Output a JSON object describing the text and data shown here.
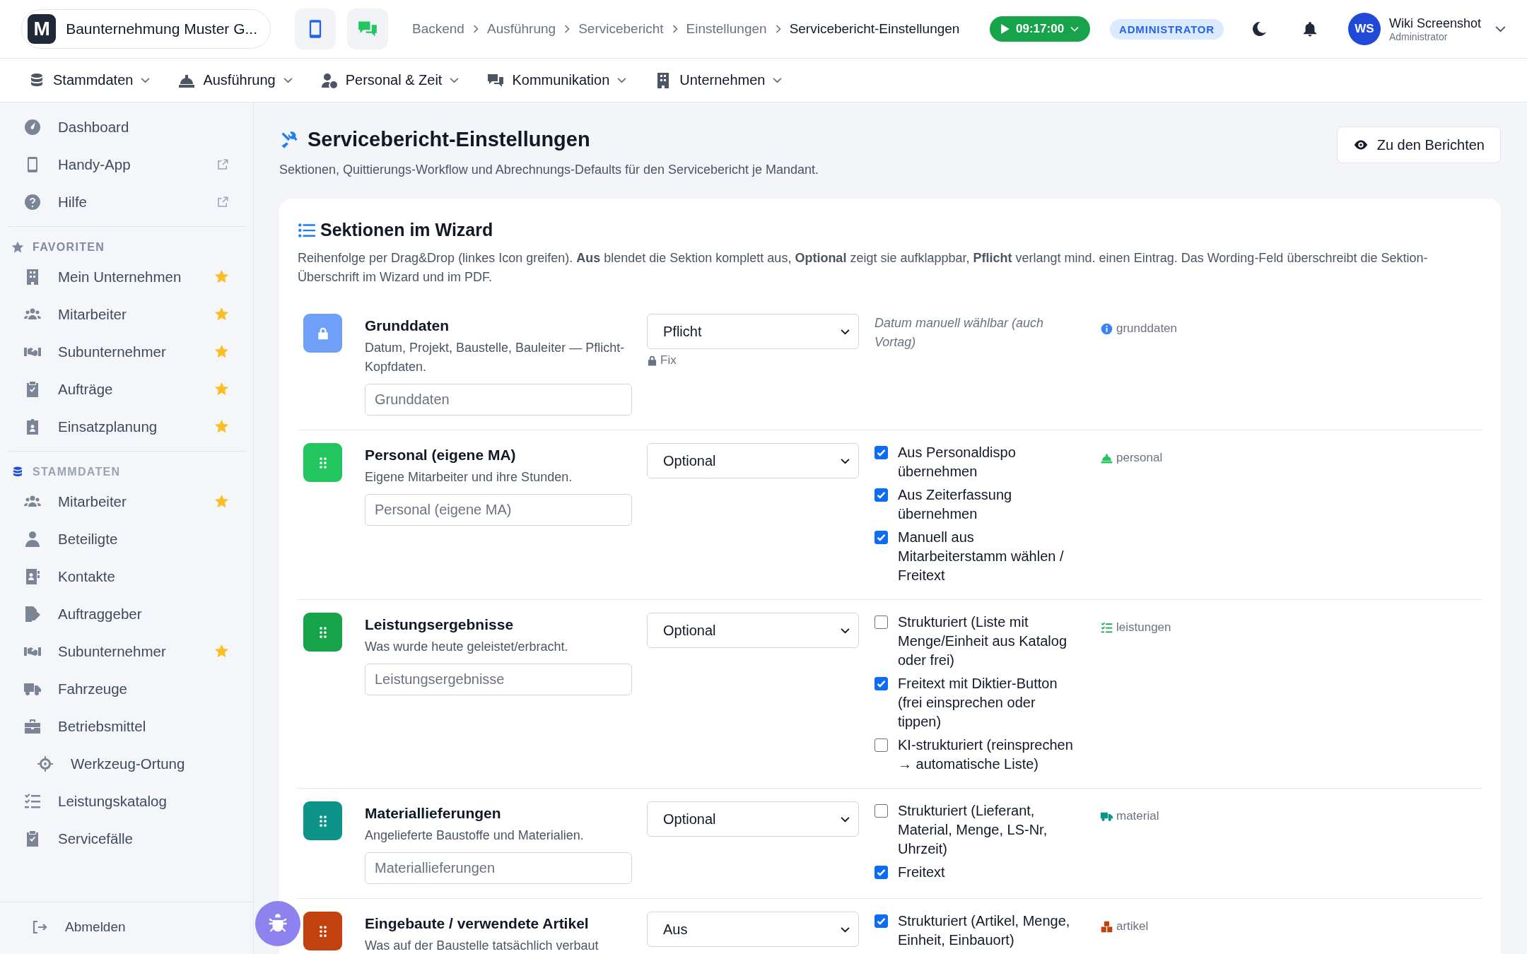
{
  "topbar": {
    "logo_letter": "M",
    "company": "Baunternehmung Muster G...",
    "breadcrumbs": [
      {
        "label": "Backend",
        "current": false
      },
      {
        "label": "Ausführung",
        "current": false
      },
      {
        "label": "Servicebericht",
        "current": false
      },
      {
        "label": "Einstellungen",
        "current": false
      },
      {
        "label": "Servicebericht-Einstellungen",
        "current": true
      }
    ],
    "timer": "09:17:00",
    "role_badge": "ADMINISTRATOR",
    "user": {
      "initials": "WS",
      "name": "Wiki Screenshot",
      "role": "Administrator"
    }
  },
  "main_nav": [
    {
      "label": "Stammdaten"
    },
    {
      "label": "Ausführung"
    },
    {
      "label": "Personal & Zeit"
    },
    {
      "label": "Kommunikation"
    },
    {
      "label": "Unternehmen"
    }
  ],
  "sidebar": {
    "groups": [
      {
        "items": [
          {
            "label": "Dashboard",
            "external": false,
            "favorite": false,
            "sub": false
          },
          {
            "label": "Handy-App",
            "external": true,
            "favorite": false,
            "sub": false
          },
          {
            "label": "Hilfe",
            "external": true,
            "favorite": false,
            "sub": false
          }
        ]
      },
      {
        "heading": "FAVORITEN",
        "items": [
          {
            "label": "Mein Unternehmen",
            "external": false,
            "favorite": true,
            "sub": false
          },
          {
            "label": "Mitarbeiter",
            "external": false,
            "favorite": true,
            "sub": false
          },
          {
            "label": "Subunternehmer",
            "external": false,
            "favorite": true,
            "sub": false
          },
          {
            "label": "Aufträge",
            "external": false,
            "favorite": true,
            "sub": false
          },
          {
            "label": "Einsatzplanung",
            "external": false,
            "favorite": true,
            "sub": false
          }
        ]
      },
      {
        "heading": "STAMMDATEN",
        "items": [
          {
            "label": "Mitarbeiter",
            "external": false,
            "favorite": true,
            "sub": false
          },
          {
            "label": "Beteiligte",
            "external": false,
            "favorite": false,
            "sub": false
          },
          {
            "label": "Kontakte",
            "external": false,
            "favorite": false,
            "sub": false
          },
          {
            "label": "Auftraggeber",
            "external": false,
            "favorite": false,
            "sub": false
          },
          {
            "label": "Subunternehmer",
            "external": false,
            "favorite": true,
            "sub": false
          },
          {
            "label": "Fahrzeuge",
            "external": false,
            "favorite": false,
            "sub": false
          },
          {
            "label": "Betriebsmittel",
            "external": false,
            "favorite": false,
            "sub": false
          },
          {
            "label": "Werkzeug-Ortung",
            "external": false,
            "favorite": false,
            "sub": true
          },
          {
            "label": "Leistungskatalog",
            "external": false,
            "favorite": false,
            "sub": false
          },
          {
            "label": "Servicefälle",
            "external": false,
            "favorite": false,
            "sub": false
          }
        ]
      }
    ],
    "logout": "Abmelden"
  },
  "page": {
    "title": "Servicebericht-Einstellungen",
    "subtitle": "Sektionen, Quittierungs-Workflow und Abrechnungs-Defaults für den Servicebericht je Mandant.",
    "reports_button": "Zu den Berichten"
  },
  "card": {
    "title": "Sektionen im Wizard",
    "intro": "Reihenfolge per Drag&Drop (linkes Icon greifen). **Aus** blendet die Sektion komplett aus, **Optional** zeigt sie aufklappbar, **Pflicht** verlangt mind. einen Eintrag. Das Wording-Feld überschreibt die Sektion-Überschrift im Wizard und im PDF.",
    "sections": [
      {
        "locked": true,
        "color": "#6ea0f7",
        "title": "Grunddaten",
        "description": "Datum, Projekt, Baustelle, Bauleiter — Pflicht-Kopfdaten.",
        "wording": "Grunddaten",
        "mode": "Pflicht",
        "fix_label": "Fix",
        "note": "Datum manuell wählbar (auch Vortag)",
        "key": {
          "color": "#3b82f6",
          "label": "grunddaten"
        }
      },
      {
        "locked": false,
        "color": "#22c55e",
        "title": "Personal (eigene MA)",
        "description": "Eigene Mitarbeiter und ihre Stunden.",
        "wording": "Personal (eigene MA)",
        "mode": "Optional",
        "options": [
          {
            "label": "Aus Personaldispo übernehmen",
            "checked": true
          },
          {
            "label": "Aus Zeiterfassung übernehmen",
            "checked": true
          },
          {
            "label": "Manuell aus Mitarbeiterstamm wählen / Freitext",
            "checked": true
          }
        ],
        "key": {
          "color": "#22c55e",
          "label": "personal"
        }
      },
      {
        "locked": false,
        "color": "#16a34a",
        "title": "Leistungsergebnisse",
        "description": "Was wurde heute geleistet/erbracht.",
        "wording": "Leistungsergebnisse",
        "mode": "Optional",
        "options": [
          {
            "label": "Strukturiert (Liste mit Menge/Einheit aus Katalog oder frei)",
            "checked": false
          },
          {
            "label": "Freitext mit Diktier-Button (frei einsprechen oder tippen)",
            "checked": true
          },
          {
            "label": "KI-strukturiert (reinsprechen → automatische Liste)",
            "checked": false
          }
        ],
        "key": {
          "color": "#16a34a",
          "label": "leistungen"
        }
      },
      {
        "locked": false,
        "color": "#0d9488",
        "title": "Materiallieferungen",
        "description": "Angelieferte Baustoffe und Materialien.",
        "wording": "Materiallieferungen",
        "mode": "Optional",
        "options": [
          {
            "label": "Strukturiert (Lieferant, Material, Menge, LS-Nr, Uhrzeit)",
            "checked": false
          },
          {
            "label": "Freitext",
            "checked": true
          }
        ],
        "key": {
          "color": "#0d9488",
          "label": "material"
        }
      },
      {
        "locked": false,
        "color": "#c2410c",
        "title": "Eingebaute / verwendete Artikel",
        "description": "Was auf der Baustelle tatsächlich verbaut",
        "mode": "Aus",
        "options": [
          {
            "label": "Strukturiert (Artikel, Menge, Einheit, Einbauort)",
            "checked": true
          }
        ],
        "key": {
          "color": "#c2410c",
          "label": "artikel"
        }
      }
    ]
  }
}
